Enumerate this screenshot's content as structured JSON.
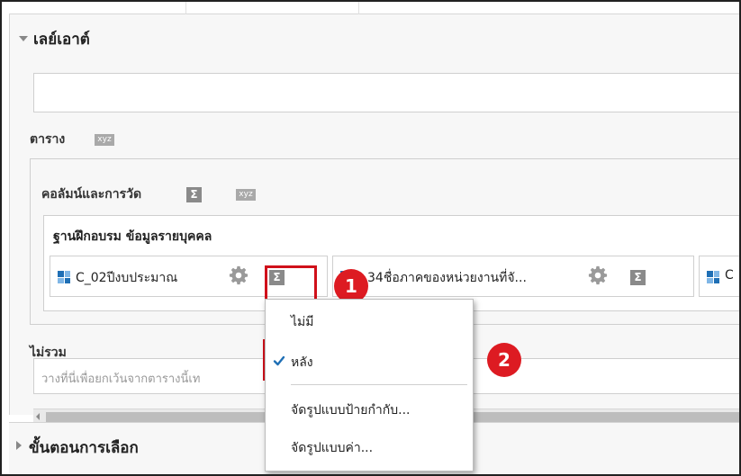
{
  "layout_section": {
    "title": "เลย์เอาต์"
  },
  "table_section": {
    "label": "ตาราง",
    "xyz_badge": "xyz"
  },
  "columns_section": {
    "label": "คอลัมน์และการวัด",
    "sigma": "Σ",
    "xyz_badge": "xyz"
  },
  "group": {
    "title": "ฐานฝึกอบรม ข้อมูลรายบุคคล",
    "columns": [
      {
        "label": "C_02ปีงบประมาณ",
        "icon": "column-grid-icon"
      },
      {
        "label": "_34ชื่อภาคของหน่วยงานที่จั...",
        "icon": "column-grid-icon"
      },
      {
        "label": "C",
        "icon": "column-grid-icon"
      }
    ],
    "sigma": "Σ"
  },
  "exclude_section": {
    "label": "ไม่รวม",
    "placeholder": "วางที่นี่เพื่อยกเว้นจากตารางนี้เท"
  },
  "steps_section": {
    "title": "ขั้นตอนการเลือก"
  },
  "context_menu": {
    "items": [
      {
        "label": "ไม่มี",
        "checked": false
      },
      {
        "label": "หลัง",
        "checked": true
      },
      {
        "label": "จัดรูปแบบป้ายกำกับ...",
        "checked": false
      },
      {
        "label": "จัดรูปแบบค่า...",
        "checked": false
      }
    ]
  },
  "markers": [
    "1",
    "2"
  ],
  "colors": {
    "highlight": "#d0101a",
    "marker": "#dd1b22",
    "check": "#1f6fb5"
  }
}
